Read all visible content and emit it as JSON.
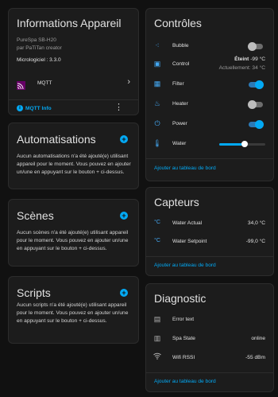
{
  "device": {
    "title": "Informations Appareil",
    "model": "PureSpa SB-H20",
    "maker": "par PaTiTan creator",
    "firmware": "Micrologiciel : 3.3.0",
    "integration": "MQTT",
    "info_link": "MQTT Info"
  },
  "automations": {
    "title": "Automatisations",
    "text": "Aucun automatisations n'a été ajouté(e) utilisant appareil pour le moment. Vous pouvez en ajouter un/une en appuyant sur le bouton + ci-dessus."
  },
  "scenes": {
    "title": "Scènes",
    "text": "Aucun scènes n'a été ajouté(e) utilisant appareil pour le moment. Vous pouvez en ajouter un/une en appuyant sur le bouton + ci-dessus."
  },
  "scripts": {
    "title": "Scripts",
    "text": "Aucun scripts n'a été ajouté(e) utilisant appareil pour le moment. Vous pouvez en ajouter un/une en appuyant sur le bouton + ci-dessus."
  },
  "controls": {
    "title": "Contrôles",
    "bubble": "Bubble",
    "bubble_on": false,
    "control": "Control",
    "control_state": "Éteint",
    "control_target": "-99 °C",
    "control_current": "Actuellement: 34 °C",
    "filter": "Filter",
    "filter_on": true,
    "heater": "Heater",
    "heater_on": false,
    "power": "Power",
    "power_on": true,
    "water": "Water",
    "water_level": 0.55,
    "add": "Ajouter au tableau de bord"
  },
  "sensors": {
    "title": "Capteurs",
    "water_actual": "Water Actual",
    "water_actual_value": "34,0 °C",
    "water_setpoint": "Water Setpoint",
    "water_setpoint_value": "-99,0 °C",
    "unit_icon": "°C",
    "add": "Ajouter au tableau de bord"
  },
  "diagnostic": {
    "title": "Diagnostic",
    "error_text": "Error text",
    "spa_state": "Spa State",
    "spa_state_value": "online",
    "wifi_rssi": "Wifi RSSI",
    "wifi_rssi_value": "-55 dBm",
    "add": "Ajouter au tableau de bord"
  },
  "colors": {
    "accent": "#03a9f4",
    "icon": "#44a8f2",
    "mqtt": "#660066"
  }
}
